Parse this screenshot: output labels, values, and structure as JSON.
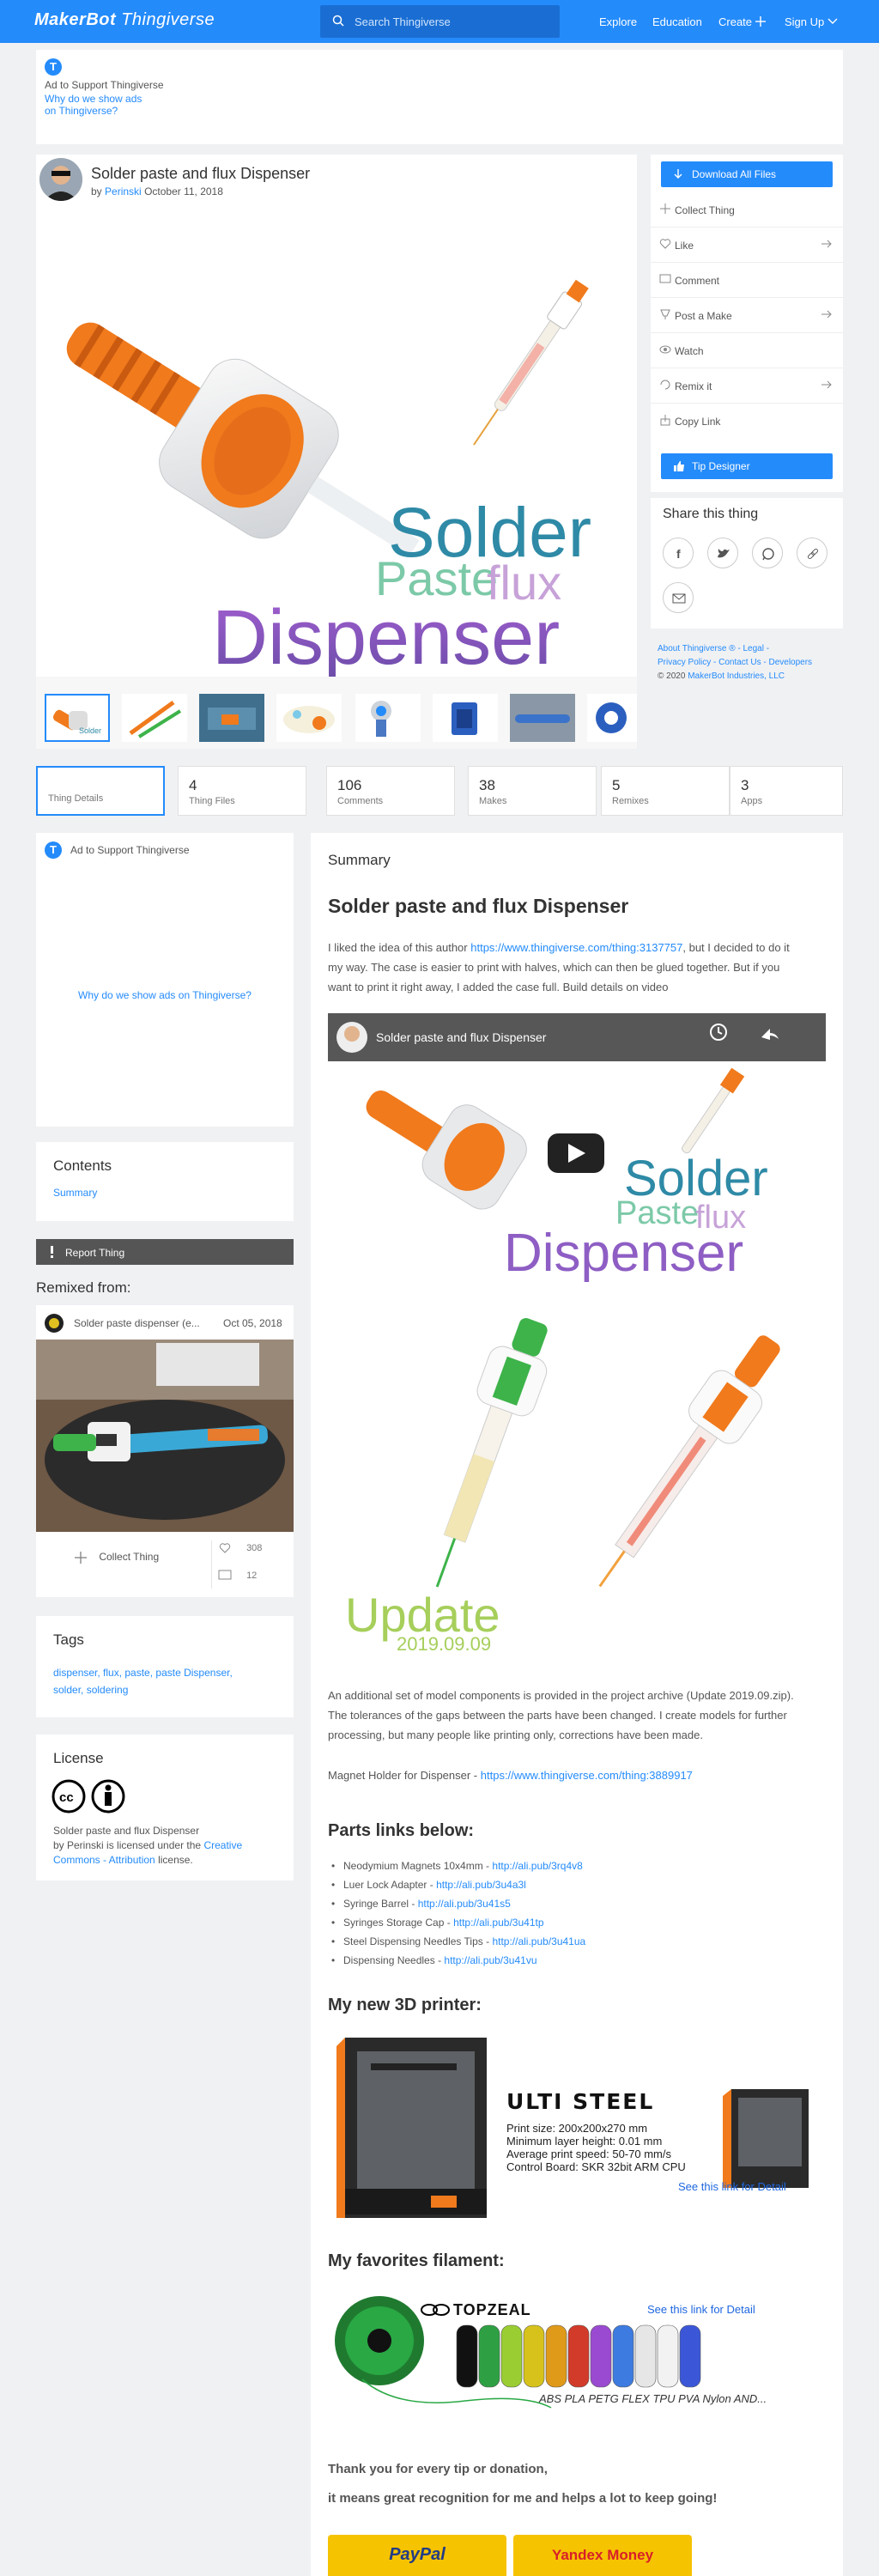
{
  "header": {
    "logo_main": "MakerBot",
    "logo_sub": "Thingiverse",
    "search_placeholder": "Search Thingiverse",
    "nav": [
      "Explore",
      "Education",
      "Create",
      "Sign Up"
    ]
  },
  "ad_top": {
    "title": "Ad to Support Thingiverse",
    "why_line1": "Why do we show ads",
    "why_line2": "on Thingiverse?"
  },
  "thing": {
    "title": "Solder paste and flux Dispenser",
    "by": "by",
    "author": "Perinski",
    "date": "October 11, 2018",
    "hero_text": [
      "Solder",
      "Paste",
      "flux",
      "Dispenser"
    ]
  },
  "actions": {
    "download": "Download All Files",
    "items": [
      "Collect Thing",
      "Like",
      "Comment",
      "Post a Make",
      "Watch",
      "Remix it",
      "Copy Link"
    ],
    "tip": "Tip Designer"
  },
  "share": {
    "title": "Share this thing"
  },
  "footer_nav": {
    "line1": "About Thingiverse ® - Legal -",
    "line2": "Privacy Policy - Contact Us - Developers",
    "copyright": "© 2020",
    "company": "MakerBot Industries, LLC"
  },
  "tabs": [
    {
      "label": "Thing Details",
      "num": ""
    },
    {
      "label": "Thing Files",
      "num": "4"
    },
    {
      "label": "Comments",
      "num": "106"
    },
    {
      "label": "Makes",
      "num": "38"
    },
    {
      "label": "Remixes",
      "num": "5"
    },
    {
      "label": "Apps",
      "num": "3"
    }
  ],
  "ad_left": {
    "title": "Ad to Support Thingiverse",
    "why": "Why do we show ads on Thingiverse?"
  },
  "contents": {
    "title": "Contents",
    "item": "Summary"
  },
  "report": "Report Thing",
  "remixed": {
    "title": "Remixed from:",
    "name": "Solder paste dispenser (e...",
    "date": "Oct 05, 2018",
    "collect": "Collect Thing",
    "likes": "308",
    "comments": "12"
  },
  "tags": {
    "title": "Tags",
    "line1": "dispenser, flux, paste, paste Dispenser,",
    "line2": "solder, soldering"
  },
  "license": {
    "title": "License",
    "line1": "Solder paste and flux Dispenser",
    "line2a": "by Perinski is licensed under the",
    "line2b": "Creative",
    "line3a": "Commons - Attribution",
    "line3b": "license."
  },
  "summary": {
    "label": "Summary",
    "title": "Solder paste and flux Dispenser",
    "intro_a": "I liked the idea of this author",
    "intro_link": "https://www.thingiverse.com/thing:3137757",
    "intro_b": ", but I decided to do it",
    "intro_line2": "my way. The case is easier to print with halves, which can then be glued together. But if you",
    "intro_line3": "want to print it right away, I added the case full. Build details on video",
    "video_title": "Solder paste and flux Dispenser",
    "update_text": "Update",
    "update_date": "2019.09.09",
    "para2_line1": "An additional set of model components is provided in the project archive (Update 2019.09.zip).",
    "para2_line2": "The tolerances of the gaps between the parts have been changed. I create models for further",
    "para2_line3": "processing, but many people like printing only, corrections have been made.",
    "magnet_label": "Magnet Holder for Dispenser -",
    "magnet_link": "https://www.thingiverse.com/thing:3889917",
    "parts_title": "Parts links below:",
    "parts": [
      {
        "name": "Neodymium Magnets 10x4mm -",
        "link": "http://ali.pub/3rq4v8"
      },
      {
        "name": "Luer Lock Adapter -",
        "link": "http://ali.pub/3u4a3l"
      },
      {
        "name": "Syringe Barrel -",
        "link": "http://ali.pub/3u41s5"
      },
      {
        "name": "Syringes Storage Cap -",
        "link": "http://ali.pub/3u41tp"
      },
      {
        "name": "Steel Dispensing Needles Tips -",
        "link": "http://ali.pub/3u41ua"
      },
      {
        "name": "Dispensing Needles -",
        "link": "http://ali.pub/3u41vu"
      }
    ],
    "printer_title": "My new 3D printer:",
    "printer_name": "ULTI STEEL",
    "printer_specs": [
      "Print size: 200x200x270 mm",
      "Minimum layer height: 0.01 mm",
      "Average print speed: 50-70 mm/s",
      "Control Board: SKR 32bit ARM CPU"
    ],
    "printer_link": "See this link for Detail",
    "filament_title": "My favorites filament:",
    "filament_brand": "TOPZEAL",
    "filament_link": "See this link for Detail",
    "filament_types": "ABS PLA PETG FLEX TPU PVA Nylon AND...",
    "thanks_line1": "Thank you for every tip or donation,",
    "thanks_line2": "it means great recognition for me and helps a lot to keep going!",
    "btn_paypal": "PayPal",
    "btn_yandex": "Yandex Money"
  },
  "colors": {
    "accent": "#248bfb",
    "orange": "#f07a1c",
    "green": "#3db34a"
  }
}
